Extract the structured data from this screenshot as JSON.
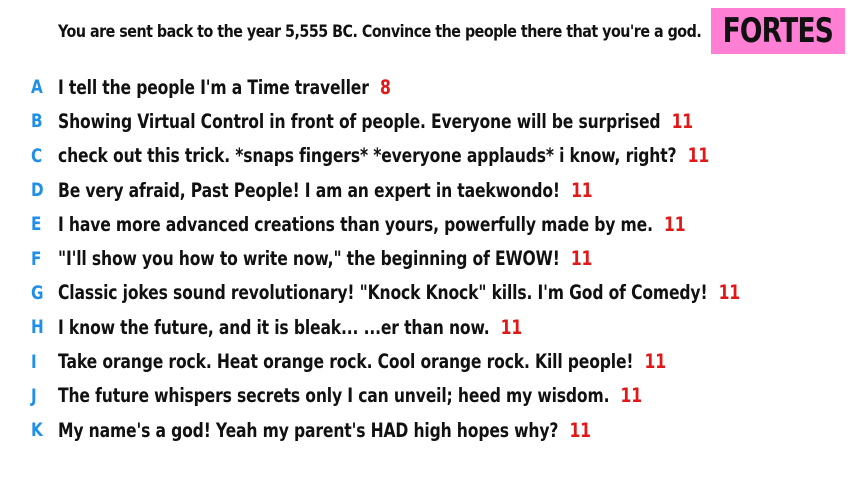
{
  "prompt": "You are sent back to the year 5,555 BC. Convince the people there that you're a god.",
  "badge": "FORTES",
  "colors": {
    "letter": "#1f8fe8",
    "score": "#e01818",
    "badge_bg": "#ff7fd4",
    "text": "#111111"
  },
  "responses": [
    {
      "letter": "A",
      "text": "I tell the people I'm a Time traveller",
      "score": "8"
    },
    {
      "letter": "B",
      "text": "Showing Virtual Control in front of people. Everyone will be surprised",
      "score": "11"
    },
    {
      "letter": "C",
      "text": "check out this trick. *snaps fingers* *everyone applauds* i know, right?",
      "score": "11"
    },
    {
      "letter": "D",
      "text": "Be very afraid, Past People! I am an expert in taekwondo!",
      "score": "11"
    },
    {
      "letter": "E",
      "text": "I have more advanced creations than yours, powerfully made by me.",
      "score": "11"
    },
    {
      "letter": "F",
      "text": "\"I'll show you how to write now,\" the beginning of EWOW!",
      "score": "11"
    },
    {
      "letter": "G",
      "text": "Classic jokes sound revolutionary! \"Knock Knock\" kills. I'm God of Comedy!",
      "score": "11"
    },
    {
      "letter": "H",
      "text": "I know the future, and it is bleak... ...er than now.",
      "score": "11"
    },
    {
      "letter": "I",
      "text": "Take orange rock. Heat orange rock. Cool orange rock. Kill people!",
      "score": "11"
    },
    {
      "letter": "J",
      "text": "The future whispers secrets only I can unveil; heed my wisdom.",
      "score": "11"
    },
    {
      "letter": "K",
      "text": "My name's a god! Yeah my parent's HAD high hopes why?",
      "score": "11"
    }
  ]
}
